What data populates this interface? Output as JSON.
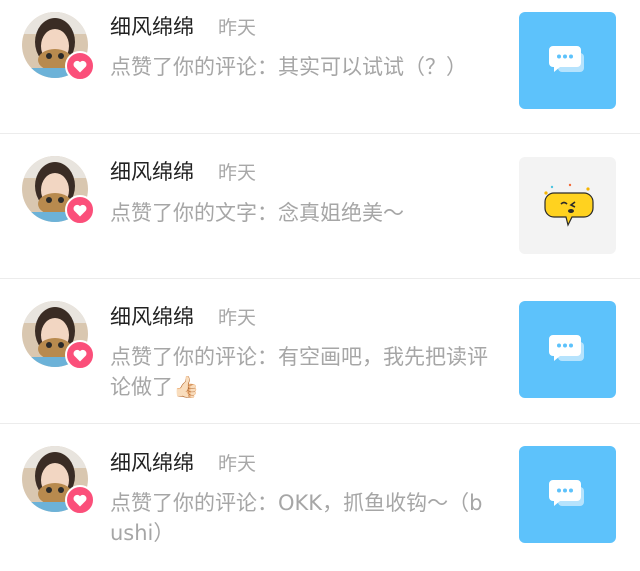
{
  "colors": {
    "badge": "#fb4f7a",
    "thumb_blue": "#5dc2fb",
    "thumb_gray": "#f3f3f3",
    "name": "#222222",
    "secondary": "#a6a6a6"
  },
  "notifications": [
    {
      "name": "细风绵绵",
      "time": "昨天",
      "message": "点赞了你的评论：其实可以试试（？）",
      "thumb_icon": "comment-bubble-icon"
    },
    {
      "name": "细风绵绵",
      "time": "昨天",
      "message": "点赞了你的文字：念真姐绝美～",
      "thumb_icon": "speech-bubble-emoji-icon"
    },
    {
      "name": "细风绵绵",
      "time": "昨天",
      "message": "点赞了你的评论：有空画吧，我先把读评论做了",
      "message_emoji": "👍🏻",
      "thumb_icon": "comment-bubble-icon"
    },
    {
      "name": "细风绵绵",
      "time": "昨天",
      "message": "点赞了你的评论：OKK，抓鱼收钩～（bushi）",
      "thumb_icon": "comment-bubble-icon"
    }
  ]
}
